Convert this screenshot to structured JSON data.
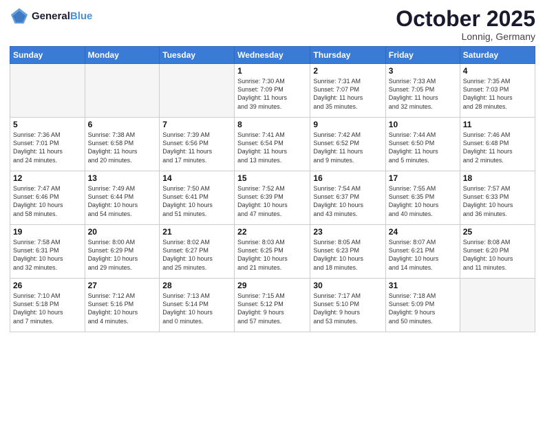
{
  "header": {
    "logo_line1": "General",
    "logo_line2": "Blue",
    "month": "October 2025",
    "location": "Lonnig, Germany"
  },
  "weekdays": [
    "Sunday",
    "Monday",
    "Tuesday",
    "Wednesday",
    "Thursday",
    "Friday",
    "Saturday"
  ],
  "weeks": [
    [
      {
        "day": "",
        "info": ""
      },
      {
        "day": "",
        "info": ""
      },
      {
        "day": "",
        "info": ""
      },
      {
        "day": "1",
        "info": "Sunrise: 7:30 AM\nSunset: 7:09 PM\nDaylight: 11 hours\nand 39 minutes."
      },
      {
        "day": "2",
        "info": "Sunrise: 7:31 AM\nSunset: 7:07 PM\nDaylight: 11 hours\nand 35 minutes."
      },
      {
        "day": "3",
        "info": "Sunrise: 7:33 AM\nSunset: 7:05 PM\nDaylight: 11 hours\nand 32 minutes."
      },
      {
        "day": "4",
        "info": "Sunrise: 7:35 AM\nSunset: 7:03 PM\nDaylight: 11 hours\nand 28 minutes."
      }
    ],
    [
      {
        "day": "5",
        "info": "Sunrise: 7:36 AM\nSunset: 7:01 PM\nDaylight: 11 hours\nand 24 minutes."
      },
      {
        "day": "6",
        "info": "Sunrise: 7:38 AM\nSunset: 6:58 PM\nDaylight: 11 hours\nand 20 minutes."
      },
      {
        "day": "7",
        "info": "Sunrise: 7:39 AM\nSunset: 6:56 PM\nDaylight: 11 hours\nand 17 minutes."
      },
      {
        "day": "8",
        "info": "Sunrise: 7:41 AM\nSunset: 6:54 PM\nDaylight: 11 hours\nand 13 minutes."
      },
      {
        "day": "9",
        "info": "Sunrise: 7:42 AM\nSunset: 6:52 PM\nDaylight: 11 hours\nand 9 minutes."
      },
      {
        "day": "10",
        "info": "Sunrise: 7:44 AM\nSunset: 6:50 PM\nDaylight: 11 hours\nand 5 minutes."
      },
      {
        "day": "11",
        "info": "Sunrise: 7:46 AM\nSunset: 6:48 PM\nDaylight: 11 hours\nand 2 minutes."
      }
    ],
    [
      {
        "day": "12",
        "info": "Sunrise: 7:47 AM\nSunset: 6:46 PM\nDaylight: 10 hours\nand 58 minutes."
      },
      {
        "day": "13",
        "info": "Sunrise: 7:49 AM\nSunset: 6:44 PM\nDaylight: 10 hours\nand 54 minutes."
      },
      {
        "day": "14",
        "info": "Sunrise: 7:50 AM\nSunset: 6:41 PM\nDaylight: 10 hours\nand 51 minutes."
      },
      {
        "day": "15",
        "info": "Sunrise: 7:52 AM\nSunset: 6:39 PM\nDaylight: 10 hours\nand 47 minutes."
      },
      {
        "day": "16",
        "info": "Sunrise: 7:54 AM\nSunset: 6:37 PM\nDaylight: 10 hours\nand 43 minutes."
      },
      {
        "day": "17",
        "info": "Sunrise: 7:55 AM\nSunset: 6:35 PM\nDaylight: 10 hours\nand 40 minutes."
      },
      {
        "day": "18",
        "info": "Sunrise: 7:57 AM\nSunset: 6:33 PM\nDaylight: 10 hours\nand 36 minutes."
      }
    ],
    [
      {
        "day": "19",
        "info": "Sunrise: 7:58 AM\nSunset: 6:31 PM\nDaylight: 10 hours\nand 32 minutes."
      },
      {
        "day": "20",
        "info": "Sunrise: 8:00 AM\nSunset: 6:29 PM\nDaylight: 10 hours\nand 29 minutes."
      },
      {
        "day": "21",
        "info": "Sunrise: 8:02 AM\nSunset: 6:27 PM\nDaylight: 10 hours\nand 25 minutes."
      },
      {
        "day": "22",
        "info": "Sunrise: 8:03 AM\nSunset: 6:25 PM\nDaylight: 10 hours\nand 21 minutes."
      },
      {
        "day": "23",
        "info": "Sunrise: 8:05 AM\nSunset: 6:23 PM\nDaylight: 10 hours\nand 18 minutes."
      },
      {
        "day": "24",
        "info": "Sunrise: 8:07 AM\nSunset: 6:21 PM\nDaylight: 10 hours\nand 14 minutes."
      },
      {
        "day": "25",
        "info": "Sunrise: 8:08 AM\nSunset: 6:20 PM\nDaylight: 10 hours\nand 11 minutes."
      }
    ],
    [
      {
        "day": "26",
        "info": "Sunrise: 7:10 AM\nSunset: 5:18 PM\nDaylight: 10 hours\nand 7 minutes."
      },
      {
        "day": "27",
        "info": "Sunrise: 7:12 AM\nSunset: 5:16 PM\nDaylight: 10 hours\nand 4 minutes."
      },
      {
        "day": "28",
        "info": "Sunrise: 7:13 AM\nSunset: 5:14 PM\nDaylight: 10 hours\nand 0 minutes."
      },
      {
        "day": "29",
        "info": "Sunrise: 7:15 AM\nSunset: 5:12 PM\nDaylight: 9 hours\nand 57 minutes."
      },
      {
        "day": "30",
        "info": "Sunrise: 7:17 AM\nSunset: 5:10 PM\nDaylight: 9 hours\nand 53 minutes."
      },
      {
        "day": "31",
        "info": "Sunrise: 7:18 AM\nSunset: 5:09 PM\nDaylight: 9 hours\nand 50 minutes."
      },
      {
        "day": "",
        "info": ""
      }
    ]
  ]
}
